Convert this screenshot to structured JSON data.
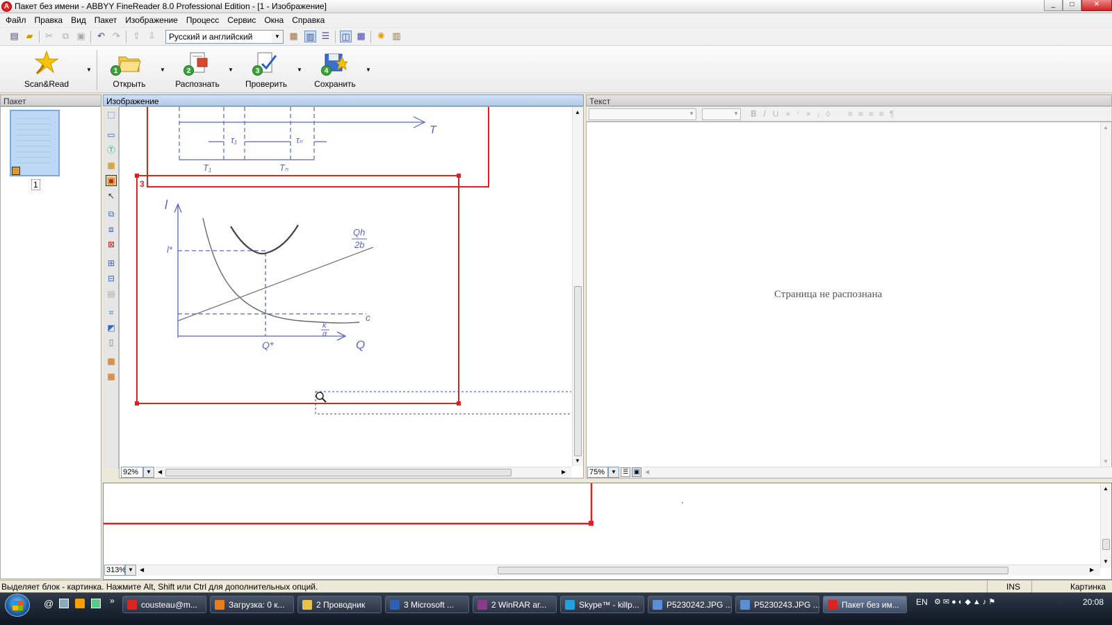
{
  "window": {
    "title": "Пакет без имени - ABBYY FineReader 8.0 Professional Edition - [1 - Изображение]",
    "controls": [
      "_",
      "□",
      "✕"
    ]
  },
  "menu": [
    "Файл",
    "Правка",
    "Вид",
    "Пакет",
    "Изображение",
    "Процесс",
    "Сервис",
    "Окна",
    "Справка"
  ],
  "toolbar": {
    "language": "Русский и английский"
  },
  "tasks": [
    {
      "num": "",
      "label": "Scan&Read"
    },
    {
      "num": "1",
      "label": "Открыть"
    },
    {
      "num": "2",
      "label": "Распознать"
    },
    {
      "num": "3",
      "label": "Проверить"
    },
    {
      "num": "4",
      "label": "Сохранить"
    }
  ],
  "batch": {
    "caption": "Пакет",
    "page_number": "1"
  },
  "image": {
    "caption": "Изображение",
    "zoom": "92%",
    "block_number": "3",
    "graph_labels": {
      "T": "T",
      "tau1": "τ₁",
      "taun": "τₙ",
      "T1": "T₁",
      "Tn": "Tₙ",
      "l": "l",
      "lstar": "l*",
      "Qh": "Qh",
      "over2b": "2b",
      "c": "c",
      "k": "k",
      "a": "α",
      "Q": "Q",
      "Qstar": "Q*"
    }
  },
  "text": {
    "caption": "Текст",
    "placeholder": "Страница не распознана",
    "zoom": "75%"
  },
  "zoomwin": {
    "zoom": "313%"
  },
  "status": {
    "message": "Выделяет блок - картинка. Нажмите Alt, Shift или Ctrl для дополнительных опций.",
    "ins": "INS",
    "mode": "Картинка"
  },
  "taskbar": {
    "buttons": [
      {
        "label": "cousteau@m...",
        "color": "#d22"
      },
      {
        "label": "Загрузка: 0 к...",
        "color": "#e87d1e"
      },
      {
        "label": "2 Проводник",
        "color": "#e8c34a"
      },
      {
        "label": "3 Microsoft ...",
        "color": "#2b5fb4"
      },
      {
        "label": "2 WinRAR ar...",
        "color": "#8b3a8b"
      },
      {
        "label": "Skype™ - killp...",
        "color": "#1fa3e0"
      },
      {
        "label": "P5230242.JPG ...",
        "color": "#5a8fd8"
      },
      {
        "label": "P5230243.JPG ...",
        "color": "#5a8fd8"
      },
      {
        "label": "Пакет без им...",
        "color": "#d22"
      }
    ],
    "lang": "EN",
    "clock": "20:08"
  }
}
